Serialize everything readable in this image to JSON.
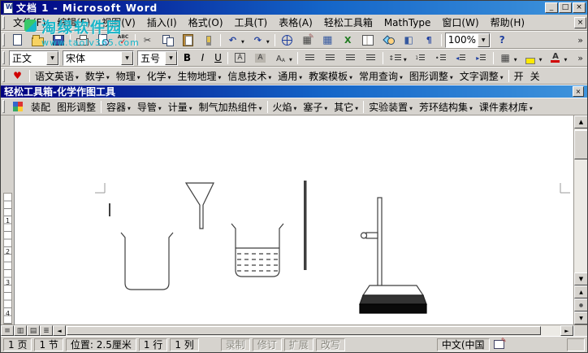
{
  "window": {
    "title": "文档 1 - Microsoft Word",
    "minimize": "_",
    "maximize": "□",
    "close": "×"
  },
  "watermark": {
    "line1": "淘绿软件园",
    "line2": "www.taolv365.com"
  },
  "menu": {
    "items": [
      {
        "name": "file",
        "label": "文件(F)"
      },
      {
        "name": "edit",
        "label": "编辑(E)"
      },
      {
        "name": "view",
        "label": "视图(V)"
      },
      {
        "name": "insert",
        "label": "插入(I)"
      },
      {
        "name": "format",
        "label": "格式(O)"
      },
      {
        "name": "tools",
        "label": "工具(T)"
      },
      {
        "name": "table",
        "label": "表格(A)"
      },
      {
        "name": "easy-toolbox",
        "label": "轻松工具箱"
      },
      {
        "name": "mathtype",
        "label": "MathType"
      },
      {
        "name": "window",
        "label": "窗口(W)"
      },
      {
        "name": "help",
        "label": "帮助(H)"
      }
    ],
    "close_doc": "×"
  },
  "standard_toolbar": {
    "buttons": [
      {
        "name": "new-document",
        "icon": true
      },
      {
        "name": "open",
        "icon": true
      },
      {
        "name": "save",
        "icon": true
      },
      {
        "sep": true
      },
      {
        "name": "print",
        "icon": true
      },
      {
        "name": "print-preview",
        "icon": true
      },
      {
        "name": "spelling",
        "icon": true
      },
      {
        "sep": true
      },
      {
        "name": "cut",
        "icon": true
      },
      {
        "name": "copy",
        "icon": true
      },
      {
        "name": "paste",
        "icon": true
      },
      {
        "name": "format-painter",
        "icon": true
      },
      {
        "sep": true
      },
      {
        "name": "undo",
        "icon": true,
        "arrow": true
      },
      {
        "name": "redo",
        "icon": true,
        "arrow": true
      },
      {
        "sep": true
      },
      {
        "name": "insert-hyperlink",
        "icon": true
      },
      {
        "name": "tables-and-borders",
        "icon": true
      },
      {
        "name": "insert-table",
        "icon": true
      },
      {
        "name": "insert-excel-worksheet",
        "icon": true
      },
      {
        "name": "columns",
        "icon": true
      },
      {
        "name": "drawing",
        "icon": true
      },
      {
        "name": "document-map",
        "icon": true
      },
      {
        "name": "show-hide-marks",
        "icon": true
      },
      {
        "sep": true
      }
    ],
    "zoom_value": "100%",
    "after_zoom": [
      {
        "name": "help",
        "icon": true
      }
    ],
    "overflow": "»"
  },
  "format_toolbar": {
    "style_value": "正文",
    "font_value": "宋体",
    "size_value": "五号",
    "buttons": [
      {
        "name": "bold",
        "label": "B"
      },
      {
        "name": "italic",
        "label": "I"
      },
      {
        "name": "underline",
        "label": "U"
      },
      {
        "sep": true
      },
      {
        "name": "char-border",
        "icon": true
      },
      {
        "name": "char-shading",
        "icon": true
      },
      {
        "name": "char-scale",
        "icon": true,
        "arrow": true
      },
      {
        "sep": true
      },
      {
        "name": "align-left",
        "icon": true
      },
      {
        "name": "align-center",
        "icon": true
      },
      {
        "name": "align-right",
        "icon": true
      },
      {
        "name": "align-justify",
        "icon": true
      },
      {
        "sep": true
      },
      {
        "name": "line-spacing",
        "icon": true,
        "arrow": true
      },
      {
        "name": "numbering",
        "icon": true
      },
      {
        "name": "bullets",
        "icon": true
      },
      {
        "name": "outdent",
        "icon": true
      },
      {
        "name": "indent",
        "icon": true
      },
      {
        "sep": true
      },
      {
        "name": "borders",
        "icon": true,
        "arrow": true
      },
      {
        "name": "highlight",
        "icon": true,
        "arrow": true
      },
      {
        "name": "font-color",
        "icon": true,
        "arrow": true
      }
    ],
    "overflow": "»"
  },
  "subject_toolbar": {
    "buttons": [
      {
        "name": "heart",
        "icon": true
      },
      {
        "sep": true
      },
      {
        "name": "chinese-english",
        "label": "语文英语",
        "arrow": true
      },
      {
        "name": "math",
        "label": "数学",
        "arrow": true
      },
      {
        "name": "physics",
        "label": "物理",
        "arrow": true
      },
      {
        "name": "chemistry",
        "label": "化学",
        "arrow": true
      },
      {
        "name": "biology-geography",
        "label": "生物地理",
        "arrow": true
      },
      {
        "name": "info-tech",
        "label": "信息技术",
        "arrow": true
      },
      {
        "name": "general",
        "label": "通用",
        "arrow": true
      },
      {
        "name": "lesson-templates",
        "label": "教案模板",
        "arrow": true
      },
      {
        "name": "common-query",
        "label": "常用查询",
        "arrow": true
      },
      {
        "name": "graphic-adjust",
        "label": "图形调整",
        "arrow": true
      },
      {
        "name": "text-adjust",
        "label": "文字调整",
        "arrow": true
      },
      {
        "sep": true
      },
      {
        "name": "toolbox-on",
        "label": "开"
      },
      {
        "name": "toolbox-off",
        "label": "关"
      }
    ]
  },
  "toolbox": {
    "title": "轻松工具箱-化学作图工具",
    "close": "×",
    "buttons": [
      {
        "name": "toolbox-logo",
        "icon": true
      },
      {
        "name": "assemble",
        "label": "装配"
      },
      {
        "name": "toolbox-graphic-adjust",
        "label": "图形调整"
      },
      {
        "sep": true
      },
      {
        "name": "containers",
        "label": "容器",
        "arrow": true
      },
      {
        "name": "tubes",
        "label": "导管",
        "arrow": true
      },
      {
        "name": "measuring",
        "label": "计量",
        "arrow": true
      },
      {
        "name": "gas-heating-components",
        "label": "制气加热组件",
        "arrow": true
      },
      {
        "sep": true
      },
      {
        "name": "flames",
        "label": "火焰",
        "arrow": true
      },
      {
        "name": "stoppers",
        "label": "塞子",
        "arrow": true
      },
      {
        "name": "others",
        "label": "其它",
        "arrow": true
      },
      {
        "sep": true
      },
      {
        "name": "experiment-setups",
        "label": "实验装置",
        "arrow": true
      },
      {
        "name": "aromatic-ring-set",
        "label": "芳环结构集",
        "arrow": true
      },
      {
        "name": "courseware-library",
        "label": "课件素材库",
        "arrow": true
      }
    ]
  },
  "ruler": {
    "numbers": [
      "1",
      "2",
      "3",
      "4"
    ]
  },
  "view_buttons": [
    {
      "name": "normal-view"
    },
    {
      "name": "web-layout-view"
    },
    {
      "name": "print-layout-view"
    },
    {
      "name": "outline-view"
    }
  ],
  "canvas": {
    "objects": [
      "beaker",
      "funnel",
      "beaker-with-liquid",
      "glass-stirring-rod",
      "iron-stand"
    ]
  },
  "status": {
    "cells": [
      {
        "name": "page-indicator",
        "label": "1 页"
      },
      {
        "name": "section-indicator",
        "label": "1 节"
      },
      {
        "name": "position-indicator",
        "label": "位置: 2.5厘米"
      },
      {
        "name": "line-indicator",
        "label": "1 行"
      },
      {
        "name": "column-indicator",
        "label": "1 列"
      }
    ],
    "toggles": [
      {
        "name": "record-macro",
        "label": "录制"
      },
      {
        "name": "track-changes",
        "label": "修订"
      },
      {
        "name": "extend-selection",
        "label": "扩展"
      },
      {
        "name": "overtype",
        "label": "改写"
      }
    ],
    "language": "中文(中国"
  }
}
